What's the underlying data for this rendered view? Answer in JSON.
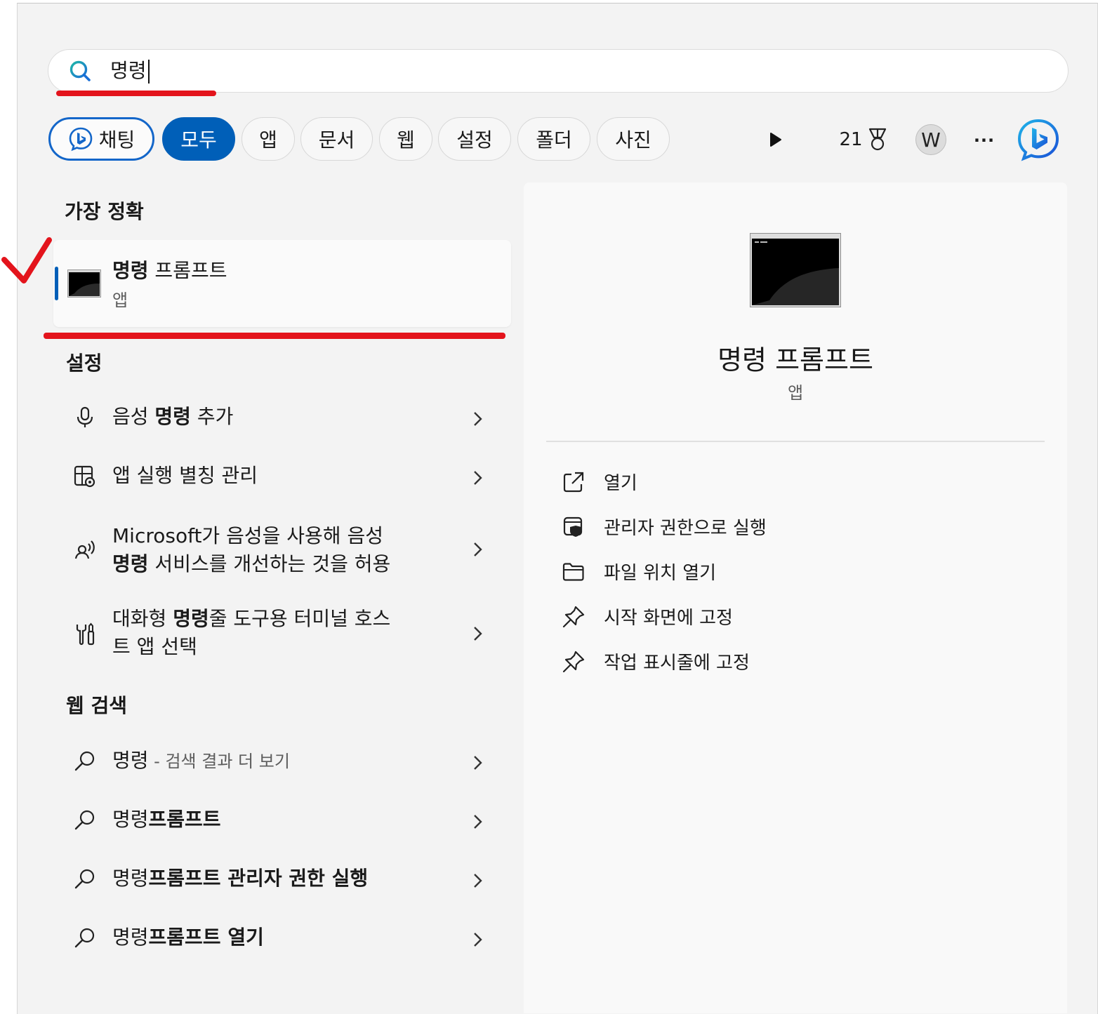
{
  "search": {
    "value": "명령"
  },
  "filters": {
    "chat": "채팅",
    "all": "모두",
    "apps": "앱",
    "documents": "문서",
    "web": "웹",
    "settings": "설정",
    "folders": "폴더",
    "photos": "사진"
  },
  "toolbar": {
    "points": "21",
    "avatar": "W",
    "more": "···"
  },
  "best_match": {
    "heading": "가장 정확",
    "title_bold": "명령",
    "title_rest": " 프롬프트",
    "subtitle": "앱"
  },
  "settings_section": {
    "heading": "설정",
    "items": [
      {
        "pre": "음성 ",
        "bold": "명령",
        "post": " 추가",
        "icon": "microphone-icon"
      },
      {
        "text": "앱 실행 별칭 관리",
        "icon": "app-settings-icon"
      },
      {
        "line1": "Microsoft가 음성을 사용해 음성",
        "bold": "명령",
        "post": " 서비스를 개선하는 것을 허용",
        "icon": "speech-icon"
      },
      {
        "pre": "대화형 ",
        "bold": "명령",
        "post1": "줄 도구용 터미널 호스",
        "line2": "트 앱 선택",
        "icon": "tools-icon"
      }
    ]
  },
  "web_section": {
    "heading": "웹 검색",
    "items": [
      {
        "query": "명령",
        "hint": " - 검색 결과 더 보기"
      },
      {
        "pre": "명령",
        "bold": "프롬프트"
      },
      {
        "pre": "명령",
        "bold": "프롬프트 관리자 권한 실행"
      },
      {
        "pre": "명령",
        "bold": "프롬프트 열기"
      }
    ]
  },
  "detail": {
    "title": "명령 프롬프트",
    "subtitle": "앱",
    "actions": [
      {
        "label": "열기",
        "icon": "open-external-icon"
      },
      {
        "label": "관리자 권한으로 실행",
        "icon": "admin-shield-icon"
      },
      {
        "label": "파일 위치 열기",
        "icon": "folder-icon"
      },
      {
        "label": "시작 화면에 고정",
        "icon": "pin-icon"
      },
      {
        "label": "작업 표시줄에 고정",
        "icon": "pin-icon"
      }
    ]
  },
  "colors": {
    "accent": "#005fb8",
    "annotation": "#e3141c",
    "bing": "#1366c9"
  }
}
